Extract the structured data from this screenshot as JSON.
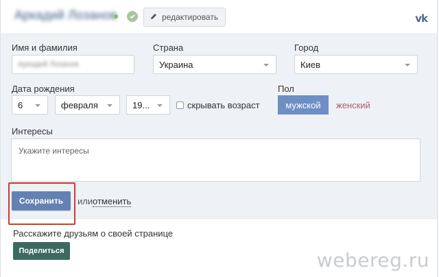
{
  "header": {
    "username": "Аркадий Лозанов",
    "edit_label": "редактировать",
    "vk_logo": "vk"
  },
  "form": {
    "name_label": "Имя и фамилия",
    "name_value": "Аркадий Лозанов",
    "country_label": "Страна",
    "country_value": "Украина",
    "city_label": "Город",
    "city_value": "Киев",
    "birth_label": "Дата рождения",
    "birth_day": "6",
    "birth_month": "февраля",
    "birth_year": "19...",
    "hide_age_label": "скрывать возраст",
    "gender_label": "Пол",
    "gender_male": "мужской",
    "gender_female": "женский",
    "interests_label": "Интересы",
    "interests_placeholder": "Укажите интересы",
    "save_label": "Сохранить",
    "or_text": "или",
    "cancel_label": "отменить"
  },
  "share": {
    "text": "Расскажите друзьям о своей странице",
    "button_label": "Поделиться"
  },
  "watermark": "webereg.ru",
  "colors": {
    "accent": "#6381b3",
    "share_button": "#3d6a60",
    "highlight_frame": "#d0392b",
    "female_text": "#b05a6e"
  }
}
